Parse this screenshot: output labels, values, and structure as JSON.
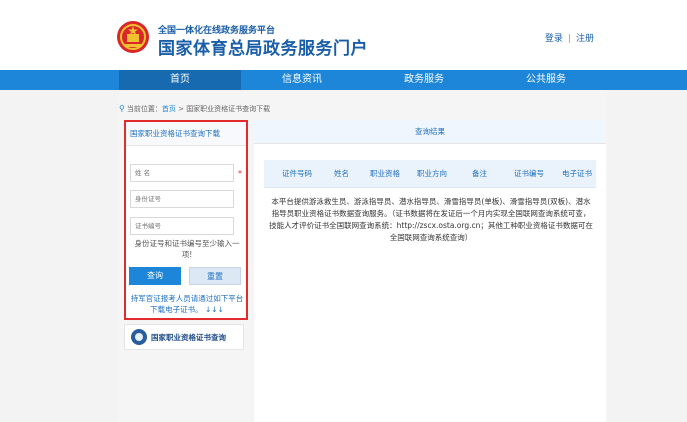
{
  "header": {
    "subtitle": "全国一体化在线政务服务平台",
    "title": "国家体育总局政务服务门户",
    "login_label": "登录",
    "separator": "|",
    "register_label": "注册"
  },
  "nav": {
    "items": [
      {
        "label": "首页"
      },
      {
        "label": "信息资讯"
      },
      {
        "label": "政务服务"
      },
      {
        "label": "公共服务"
      }
    ]
  },
  "breadcrumb": {
    "prefix": "当前位置：",
    "home": "首页",
    "separator": " > ",
    "current": "国家职业资格证书查询下载"
  },
  "left_panel": {
    "title": "国家职业资格证书查询下载",
    "name_placeholder": "姓 名",
    "required_mark": "*",
    "id_placeholder": "身份证号",
    "cert_placeholder": "证书编号",
    "hint": "身份证号和证书编号至少输入一项!",
    "query_label": "查询",
    "reset_label": "重置",
    "notice": "持军官证报考人员请通过如下平台下载电子证书。 ↓↓↓"
  },
  "banner": {
    "text": "国家职业资格证书查询"
  },
  "right_panel": {
    "title": "查询结果",
    "columns": [
      "证件号码",
      "姓名",
      "职业资格",
      "职业方向",
      "备注",
      "证书编号",
      "电子证书"
    ],
    "description": "本平台提供游泳救生员、游泳指导员、潜水指导员、滑雪指导员(单板)、滑雪指导员(双板)、潜水指导员职业资格证书数据查询服务。（证书数据将在发证后一个月内实现全国联网查询系统可查，技能人才评价证书全国联网查询系统：http://zscx.osta.org.cn；其他工种职业资格证书数据可在全国联网查询系统查询）"
  },
  "colors": {
    "brand_blue": "#1a5ea9",
    "nav_blue": "#1e86d8",
    "highlight_red": "#e22b2b"
  }
}
